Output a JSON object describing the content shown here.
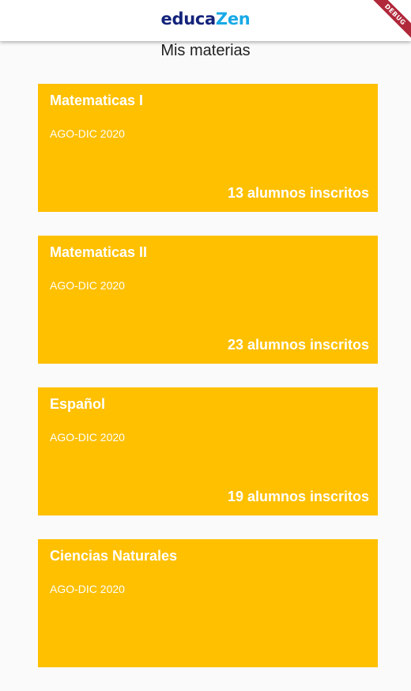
{
  "app": {
    "logo_part1": "educa",
    "logo_part2": "Zen",
    "debug_label": "DEBUG"
  },
  "colors": {
    "logo_primary": "#14237a",
    "logo_accent": "#18a9e6",
    "card_background": "#ffc000",
    "page_background": "#fafafa"
  },
  "page": {
    "title": "Mis materias"
  },
  "courses": [
    {
      "name": "Matematicas I",
      "period": "AGO-DIC 2020",
      "enrolled": "13 alumnos inscritos"
    },
    {
      "name": "Matematicas II",
      "period": "AGO-DIC 2020",
      "enrolled": "23 alumnos inscritos"
    },
    {
      "name": "Español",
      "period": "AGO-DIC 2020",
      "enrolled": "19 alumnos inscritos"
    },
    {
      "name": "Ciencias Naturales",
      "period": "AGO-DIC 2020",
      "enrolled": ""
    }
  ]
}
